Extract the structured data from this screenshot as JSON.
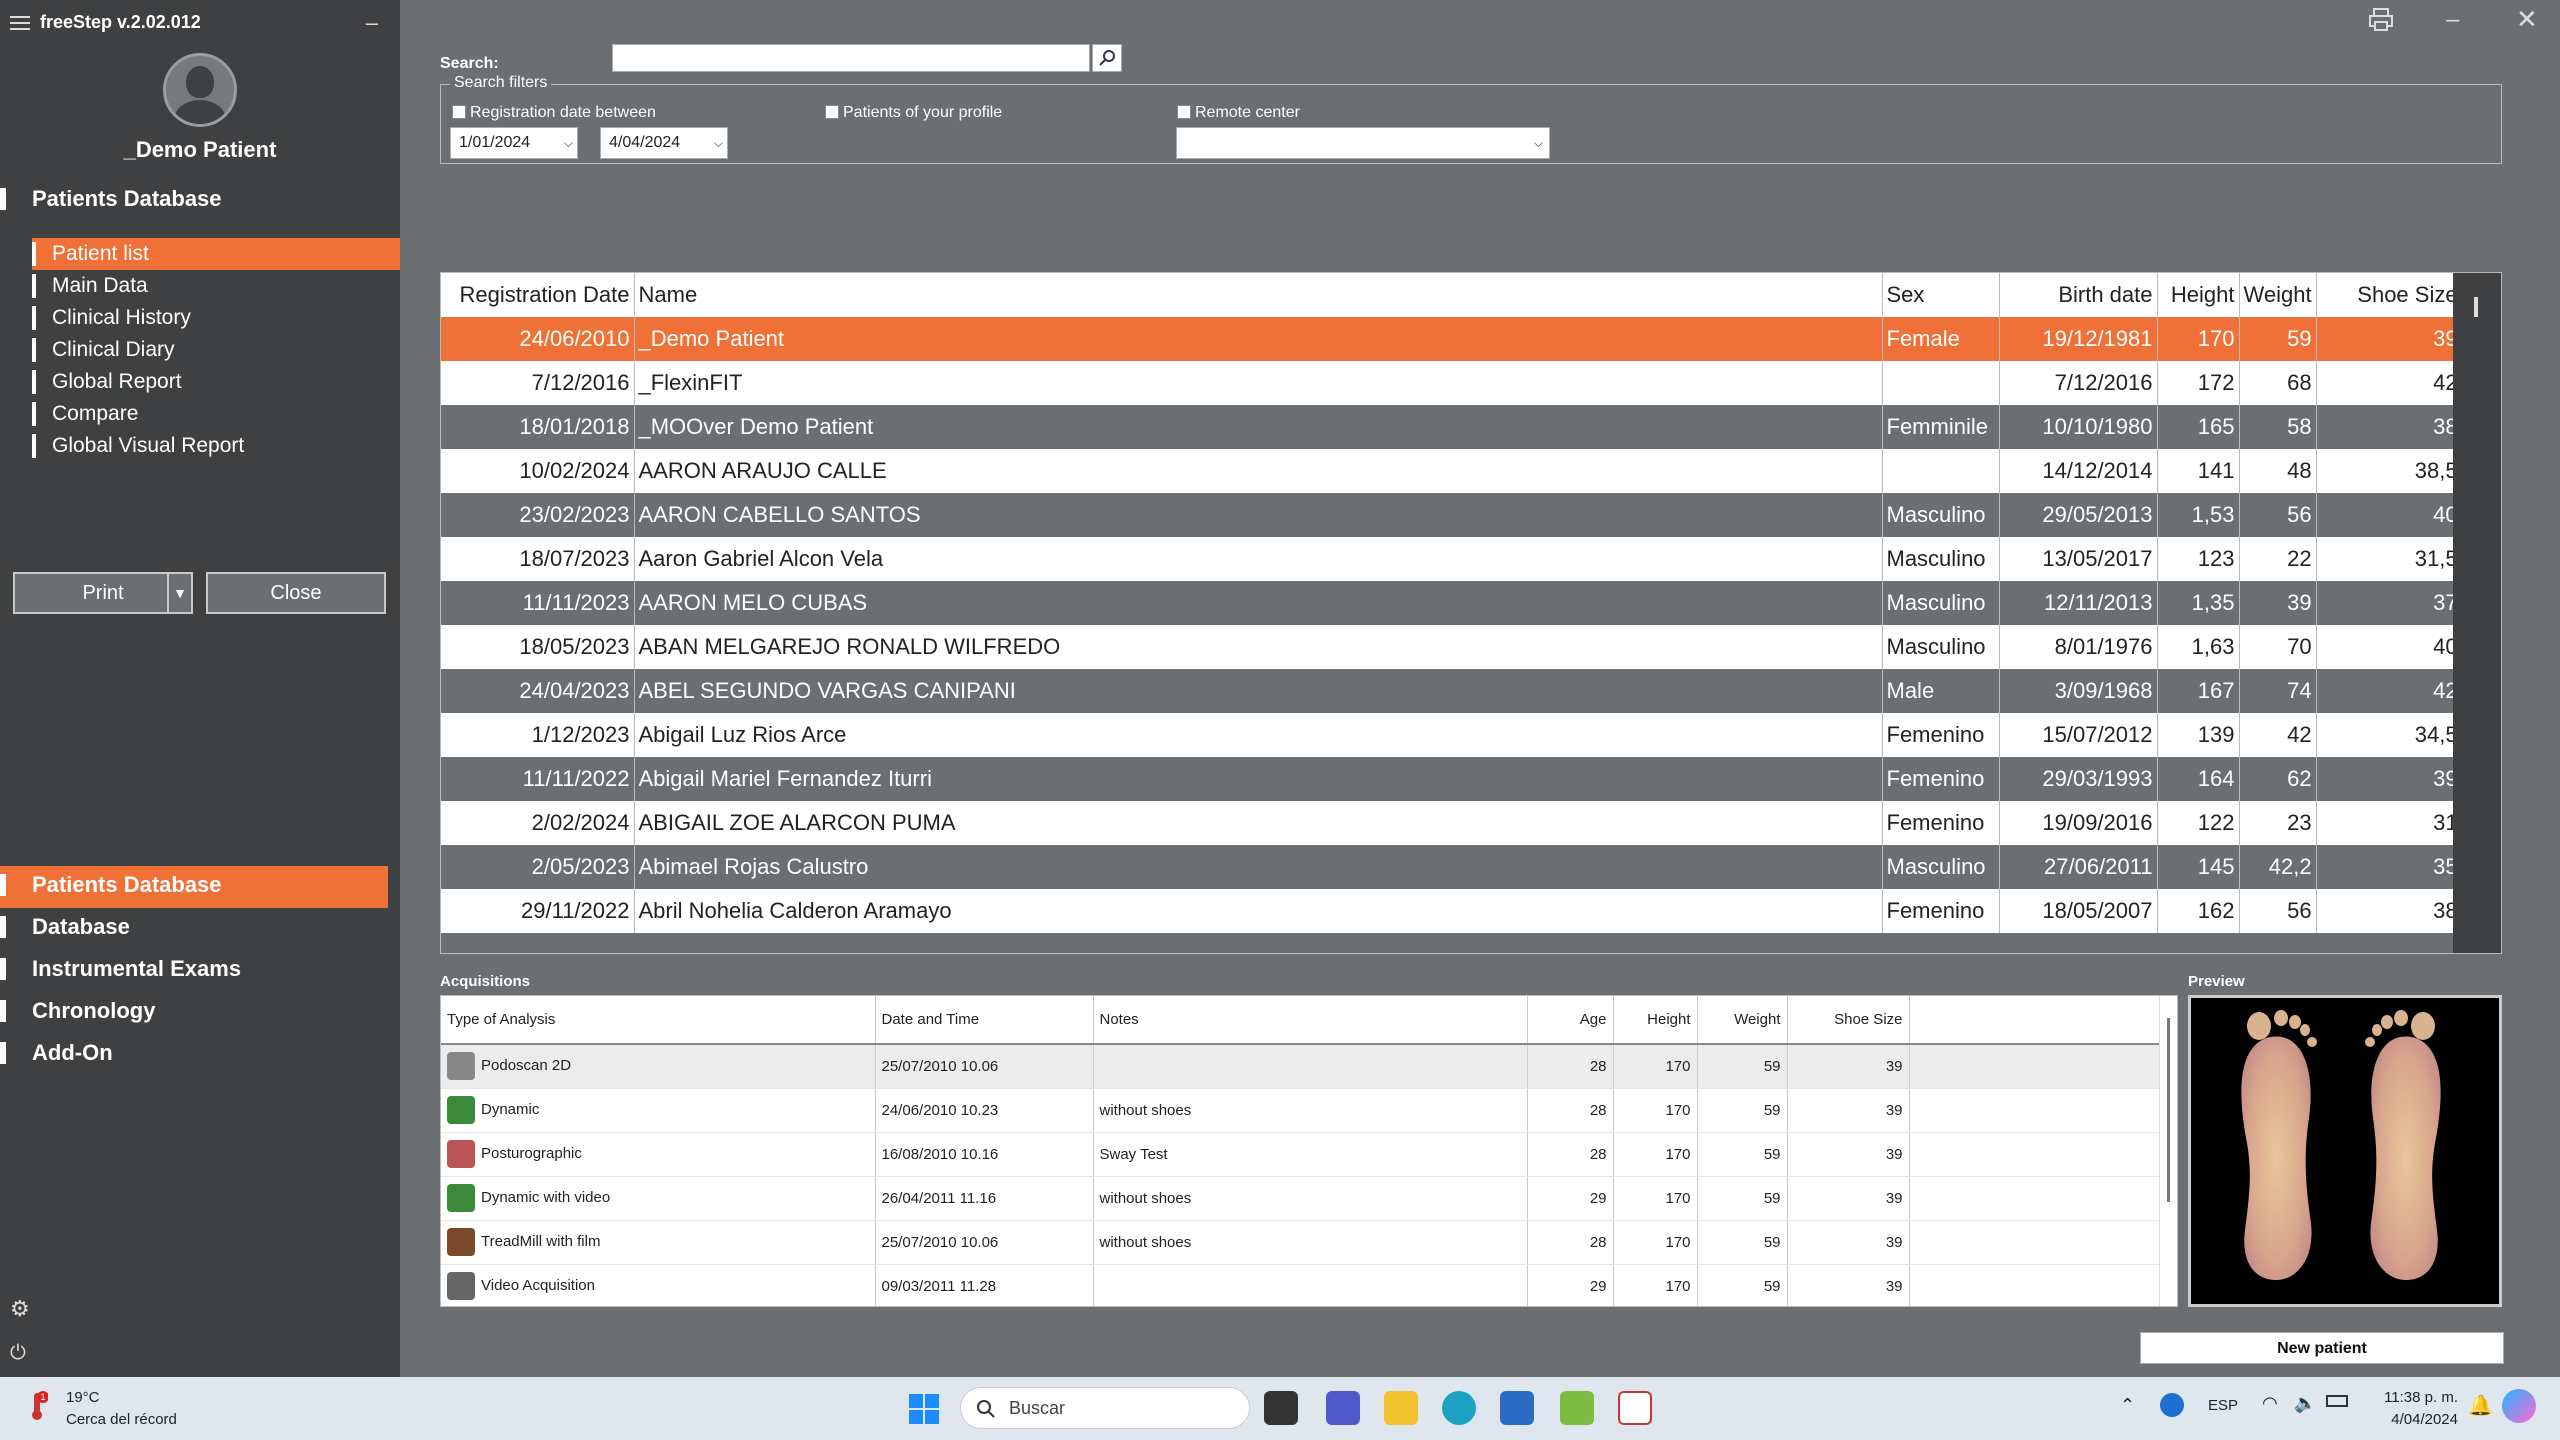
{
  "app": {
    "title": "freeStep v.2.02.012"
  },
  "patient": {
    "name": "_Demo Patient"
  },
  "sidebar": {
    "section_title": "Patients Database",
    "items": [
      {
        "label": "Patient list",
        "active": true
      },
      {
        "label": "Main Data"
      },
      {
        "label": "Clinical History"
      },
      {
        "label": "Clinical Diary"
      },
      {
        "label": "Global Report"
      },
      {
        "label": "Compare"
      },
      {
        "label": "Global Visual Report"
      }
    ],
    "print_label": "Print",
    "close_label": "Close",
    "bottom_items": [
      {
        "label": "Patients Database",
        "active": true
      },
      {
        "label": "Database"
      },
      {
        "label": "Instrumental Exams"
      },
      {
        "label": "Chronology"
      },
      {
        "label": "Add-On"
      }
    ]
  },
  "search": {
    "label": "Search:",
    "value": "",
    "filters_title": "Search filters",
    "registration_between_label": "Registration date between",
    "date_from": "1/01/2024",
    "date_to": "4/04/2024",
    "profile_label": "Patients of your profile",
    "remote_label": "Remote center",
    "remote_value": ""
  },
  "patients": {
    "columns": [
      "Registration Date",
      "Name",
      "Sex",
      "Birth date",
      "Height",
      "Weight",
      "Shoe Size"
    ],
    "rows": [
      [
        "24/06/2010",
        "_Demo Patient",
        "Female",
        "19/12/1981",
        "170",
        "59",
        "39"
      ],
      [
        "7/12/2016",
        "_FlexinFIT",
        "",
        "7/12/2016",
        "172",
        "68",
        "42"
      ],
      [
        "18/01/2018",
        "_MOOver Demo Patient",
        "Femminile",
        "10/10/1980",
        "165",
        "58",
        "38"
      ],
      [
        "10/02/2024",
        "AARON ARAUJO CALLE",
        "",
        "14/12/2014",
        "141",
        "48",
        "38,5"
      ],
      [
        "23/02/2023",
        "AARON CABELLO SANTOS",
        "Masculino",
        "29/05/2013",
        "1,53",
        "56",
        "40"
      ],
      [
        "18/07/2023",
        "Aaron Gabriel Alcon Vela",
        "Masculino",
        "13/05/2017",
        "123",
        "22",
        "31,5"
      ],
      [
        "11/11/2023",
        "AARON MELO CUBAS",
        "Masculino",
        "12/11/2013",
        "1,35",
        "39",
        "37"
      ],
      [
        "18/05/2023",
        "ABAN MELGAREJO RONALD WILFREDO",
        "Masculino",
        "8/01/1976",
        "1,63",
        "70",
        "40"
      ],
      [
        "24/04/2023",
        "ABEL SEGUNDO VARGAS CANIPANI",
        "Male",
        "3/09/1968",
        "167",
        "74",
        "42"
      ],
      [
        "1/12/2023",
        "Abigail Luz Rios Arce",
        "Femenino",
        "15/07/2012",
        "139",
        "42",
        "34,5"
      ],
      [
        "11/11/2022",
        "Abigail Mariel Fernandez Iturri",
        "Femenino",
        "29/03/1993",
        "164",
        "62",
        "39"
      ],
      [
        "2/02/2024",
        "ABIGAIL ZOE ALARCON PUMA",
        "Femenino",
        "19/09/2016",
        "122",
        "23",
        "31"
      ],
      [
        "2/05/2023",
        "Abimael Rojas Calustro",
        "Masculino",
        "27/06/2011",
        "145",
        "42,2",
        "35"
      ],
      [
        "29/11/2022",
        "Abril Nohelia Calderon Aramayo",
        "Femenino",
        "18/05/2007",
        "162",
        "56",
        "38"
      ]
    ]
  },
  "acquisitions": {
    "title": "Acquisitions",
    "columns": [
      "Type of Analysis",
      "Date and Time",
      "Notes",
      "Age",
      "Height",
      "Weight",
      "Shoe Size"
    ],
    "rows": [
      [
        "Podoscan 2D",
        "25/07/2010 10.06",
        "",
        "28",
        "170",
        "59",
        "39"
      ],
      [
        "Dynamic",
        "24/06/2010 10.23",
        "without shoes",
        "28",
        "170",
        "59",
        "39"
      ],
      [
        "Posturographic",
        "16/08/2010 10.16",
        "Sway Test",
        "28",
        "170",
        "59",
        "39"
      ],
      [
        "Dynamic with video",
        "26/04/2011 11.16",
        "without shoes",
        "29",
        "170",
        "59",
        "39"
      ],
      [
        "TreadMill with film",
        "25/07/2010 10.06",
        "without shoes",
        "28",
        "170",
        "59",
        "39"
      ],
      [
        "Video Acquisition",
        "09/03/2011 11.28",
        "",
        "29",
        "170",
        "59",
        "39"
      ]
    ]
  },
  "preview": {
    "title": "Preview"
  },
  "new_patient_label": "New patient",
  "taskbar": {
    "weather_temp": "19°C",
    "weather_desc": "Cerca del récord",
    "weather_badge": "1",
    "search_text": "Buscar",
    "lang": "ESP",
    "time": "11:38 p. m.",
    "date": "4/04/2024"
  },
  "colors": {
    "accent": "#ef7138",
    "sidebar_bg": "#3e4042",
    "main_bg": "#6b6f72"
  }
}
